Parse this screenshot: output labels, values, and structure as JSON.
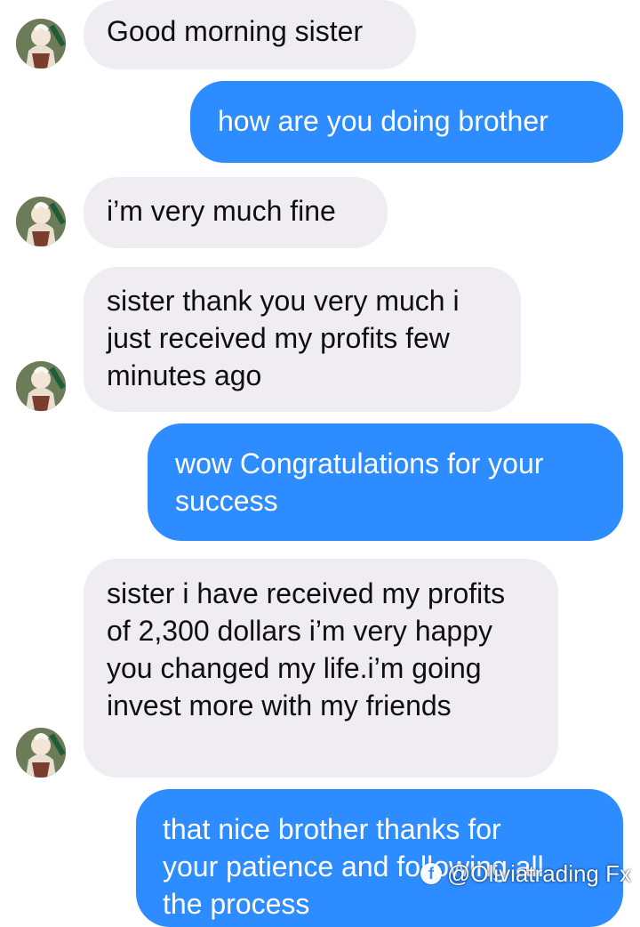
{
  "chat": {
    "messages": [
      {
        "direction": "incoming",
        "text": "Good morning sister"
      },
      {
        "direction": "outgoing",
        "text": "how are you doing brother"
      },
      {
        "direction": "incoming",
        "text": "i’m very much fine"
      },
      {
        "direction": "incoming",
        "text": "sister thank you very much i\njust received my profits few\nminutes ago"
      },
      {
        "direction": "outgoing",
        "text": "wow Congratulations for your\nsuccess"
      },
      {
        "direction": "incoming",
        "text": "sister i have received my profits\nof 2,300 dollars i’m very happy\nyou changed my life.i’m going\ninvest more with my friends"
      },
      {
        "direction": "outgoing",
        "text": "that nice brother thanks for\nyour patience and following all\nthe process"
      }
    ],
    "avatar_icon": "profile-photo-icon"
  },
  "watermark": {
    "icon": "facebook-icon",
    "text": "@Oliviatrading Fx"
  },
  "colors": {
    "incoming_bubble": "#efedf2",
    "outgoing_bubble": "#2d8cff",
    "incoming_text": "#0f0f10",
    "outgoing_text": "#ffffff"
  }
}
